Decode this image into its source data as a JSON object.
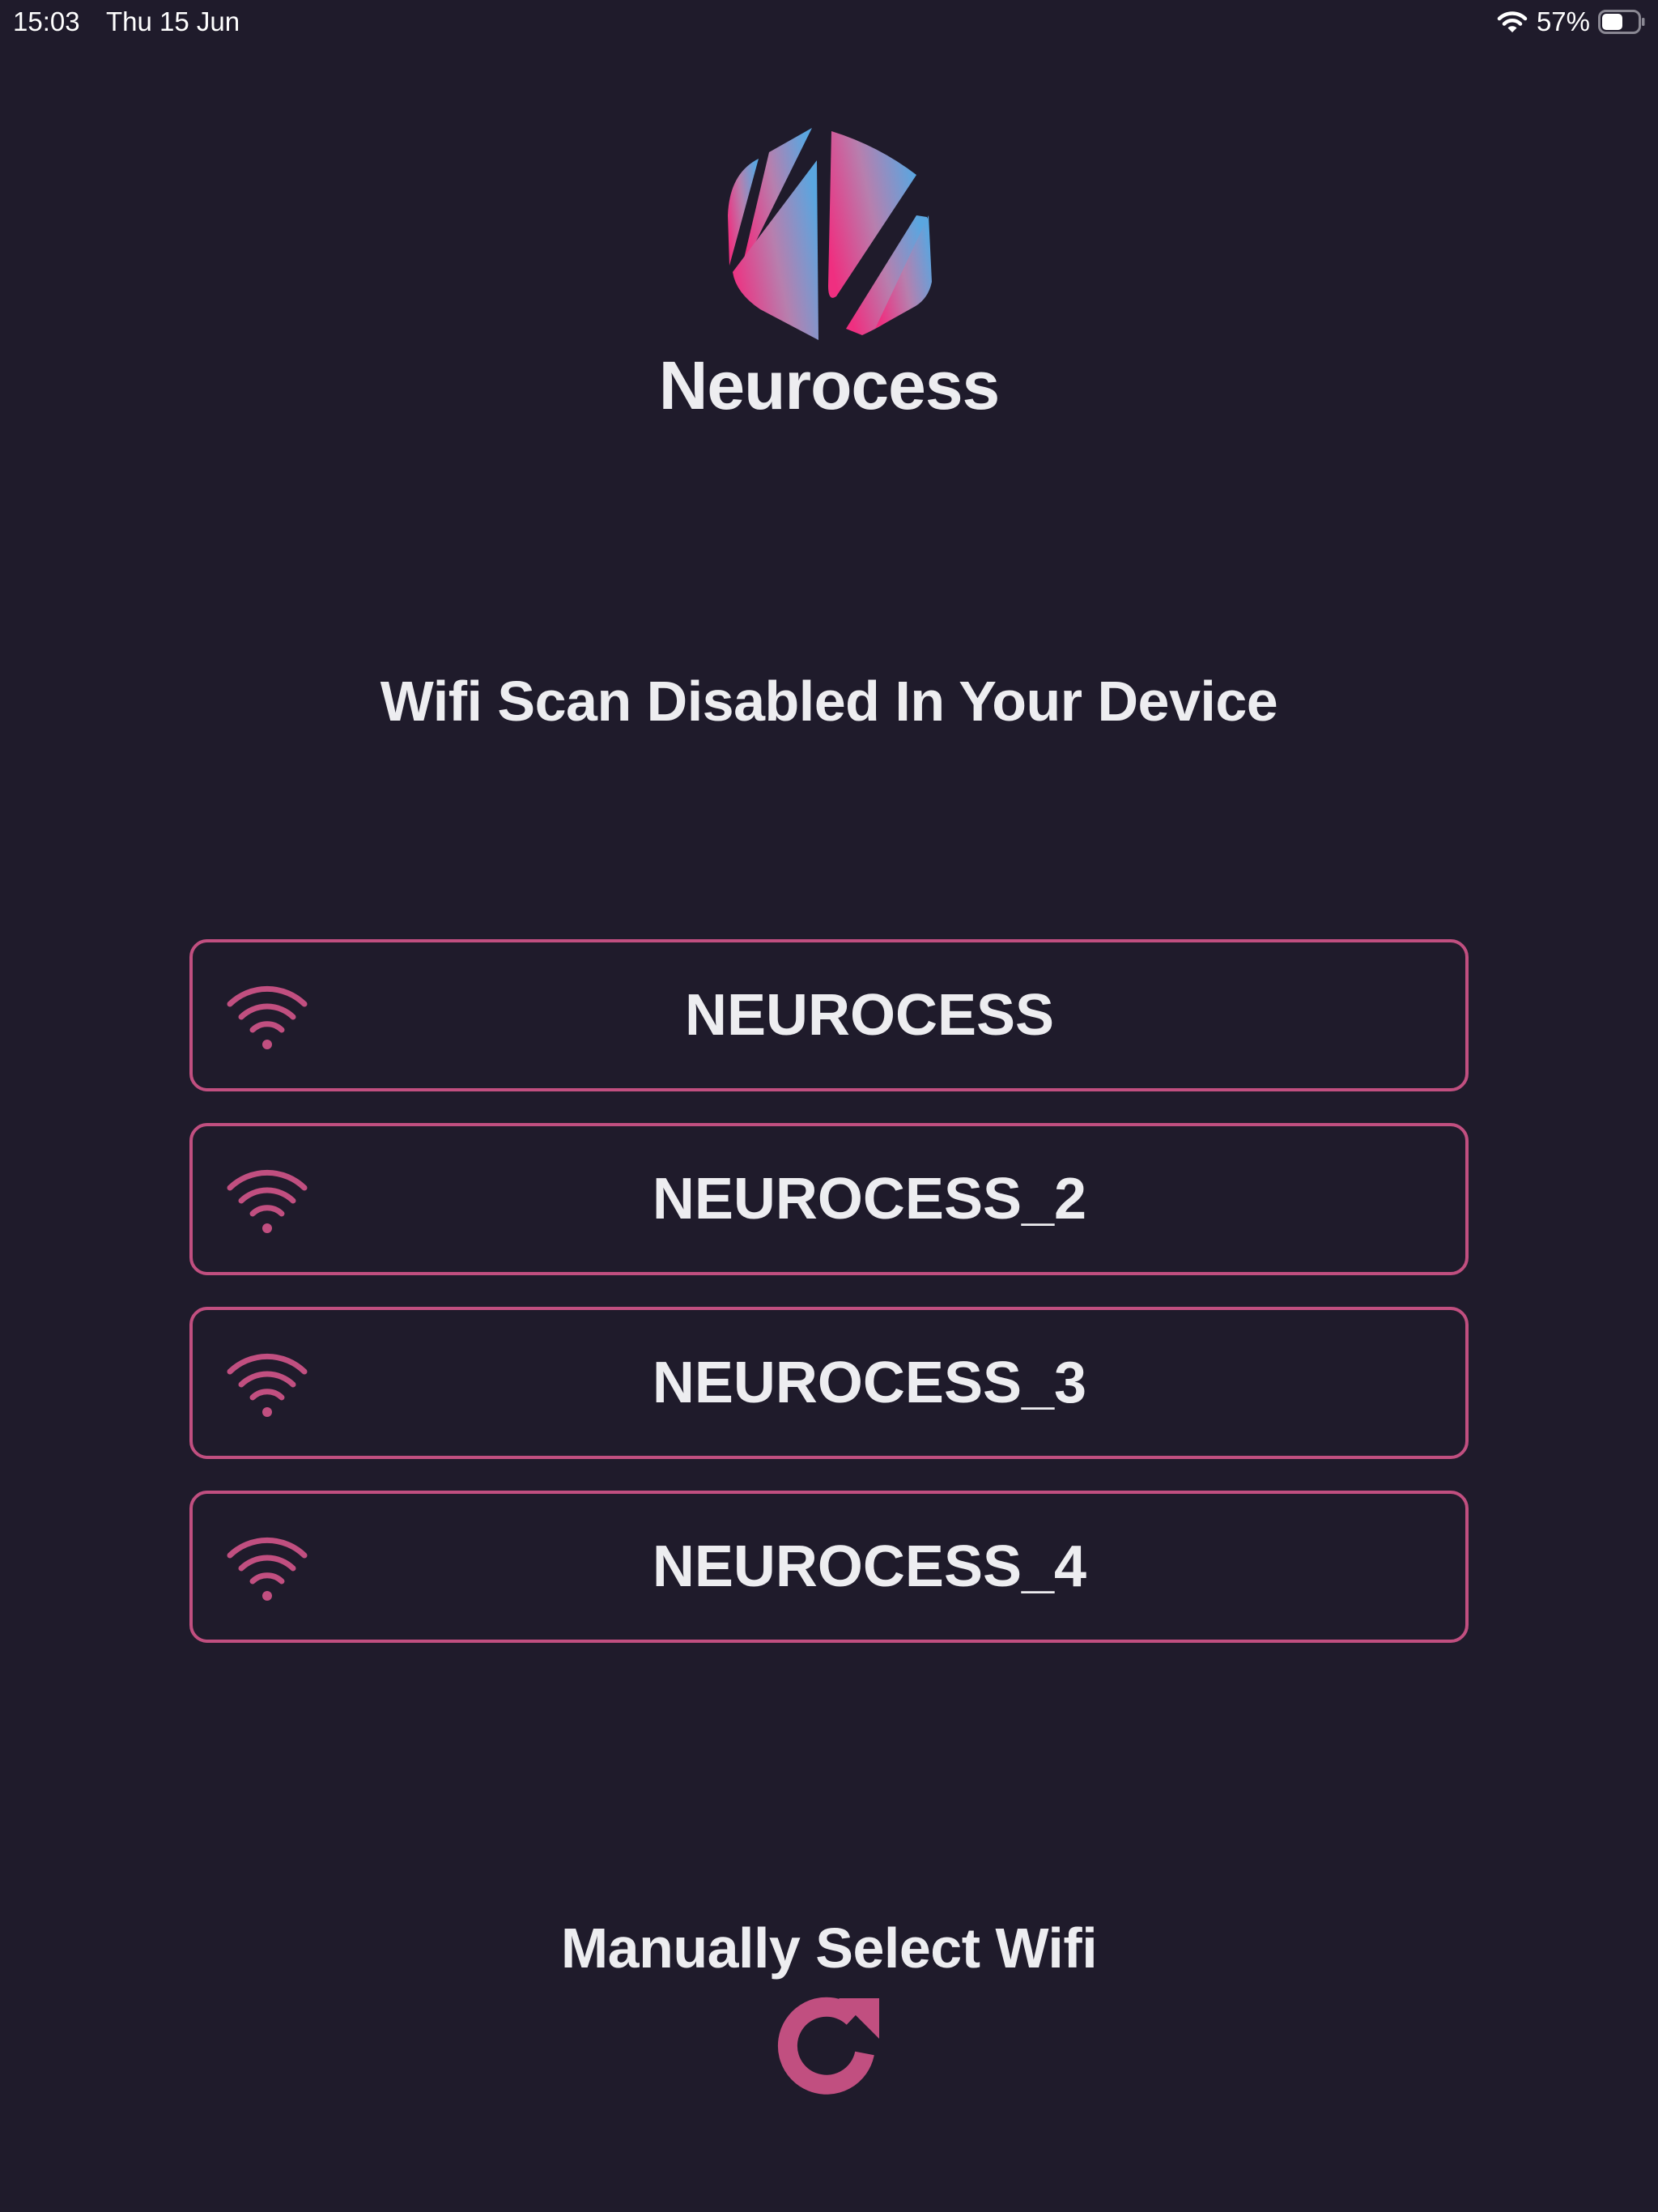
{
  "status_bar": {
    "time": "15:03",
    "date": "Thu 15 Jun",
    "battery_percent": "57%",
    "battery_level": 0.57
  },
  "brand": {
    "name": "Neurocess",
    "logo_icon": "neurocess-logo-icon",
    "gradient_colors": [
      "#ef2f80",
      "#5aa6e0"
    ]
  },
  "headline": "Wifi Scan Disabled In Your Device",
  "wifi_networks": [
    {
      "ssid": "NEUROCESS",
      "icon": "wifi-icon"
    },
    {
      "ssid": "NEUROCESS_2",
      "icon": "wifi-icon"
    },
    {
      "ssid": "NEUROCESS_3",
      "icon": "wifi-icon"
    },
    {
      "ssid": "NEUROCESS_4",
      "icon": "wifi-icon"
    }
  ],
  "manual_select": {
    "label": "Manually Select Wifi",
    "icon": "refresh-icon"
  },
  "colors": {
    "background": "#1f1b2b",
    "accent": "#c14f80",
    "text": "#ededf0"
  }
}
